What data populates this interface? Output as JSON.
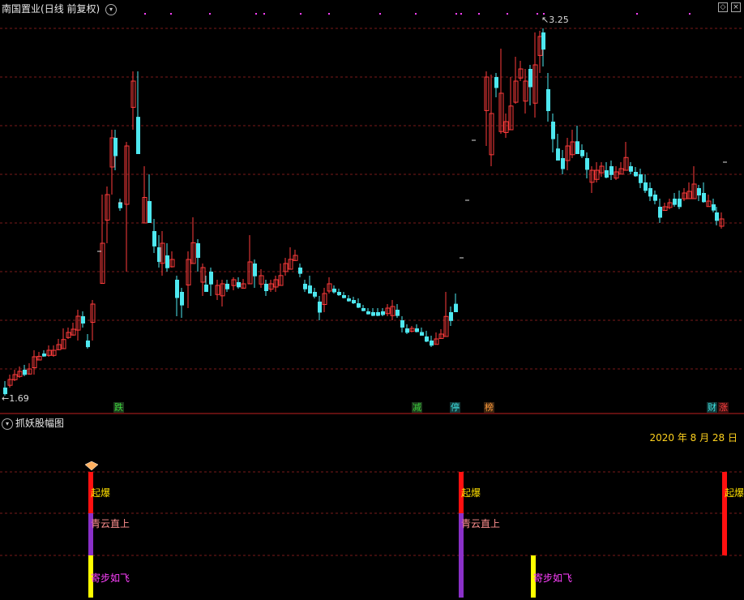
{
  "header": {
    "stock": "南国置业",
    "mode": "(日线 前复权)",
    "dropdown_icon": "chevron-down-icon",
    "corner_diamond_icon": "diamond-icon",
    "corner_close_icon": "close-icon"
  },
  "price_labels": {
    "high": "3.25",
    "low": "1.69"
  },
  "event_tags": [
    {
      "text": "跌",
      "color": "#3ad13a",
      "bg": "#1c3a1c"
    },
    {
      "text": "减",
      "color": "#3ad13a",
      "bg": "#1c3a1c"
    },
    {
      "text": "停",
      "color": "#40e0e0",
      "bg": "#123a3a"
    },
    {
      "text": "榜",
      "color": "#ff9b3a",
      "bg": "#3a2410"
    },
    {
      "text": "财",
      "color": "#40e0e0",
      "bg": "#123a3a"
    },
    {
      "text": "涨",
      "color": "#ff4040",
      "bg": "#3a1010"
    }
  ],
  "indicator": {
    "name": "抓妖股幅图",
    "date": "2020 年 8 月 28 日",
    "signals": [
      "起爆",
      "青云直上",
      "寄步如飞"
    ]
  },
  "colors": {
    "up": "#ff3b3b",
    "down": "#4ee8f0",
    "grid": "#7a1a1a",
    "signal_red": "#ff1010",
    "signal_purple": "#8a30c8",
    "signal_yellow": "#ffff00",
    "signal_text_red": "#ffe000",
    "signal_text_purple": "#ff9090",
    "signal_text_yellow": "#ff40ff"
  }
}
